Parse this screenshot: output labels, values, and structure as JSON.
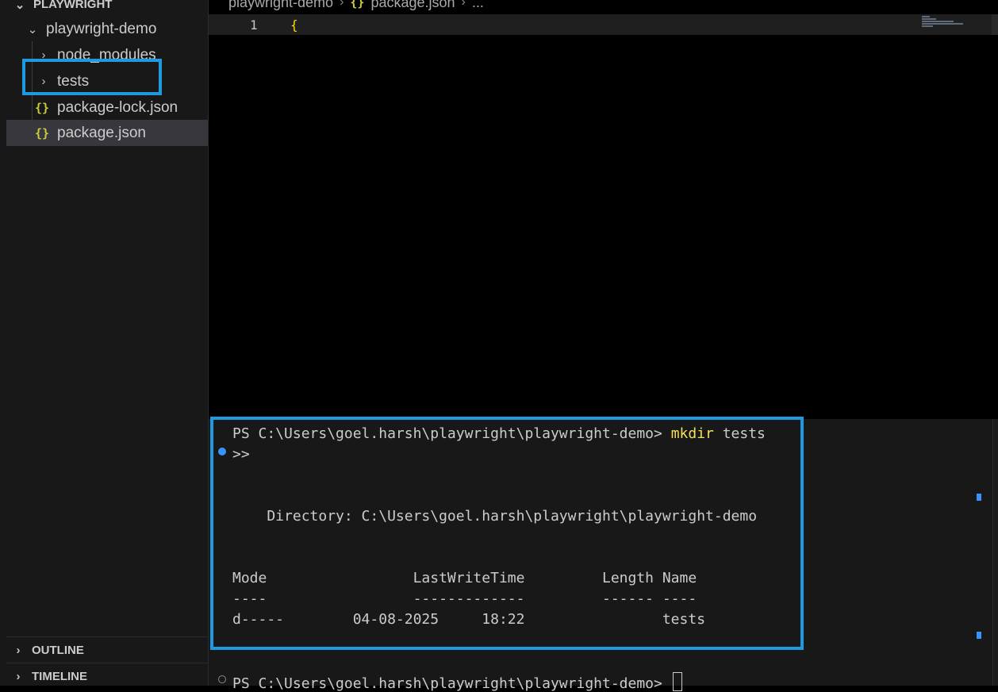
{
  "sidebar": {
    "root_label": "PLAYWRIGHT",
    "items": [
      {
        "label": "playwright-demo",
        "kind": "folder",
        "expanded": true
      },
      {
        "label": "node_modules",
        "kind": "folder",
        "expanded": false
      },
      {
        "label": "tests",
        "kind": "folder",
        "expanded": false
      },
      {
        "label": "package-lock.json",
        "kind": "json-file"
      },
      {
        "label": "package.json",
        "kind": "json-file",
        "selected": true
      }
    ],
    "json_icon_glyph": "{}",
    "outline_label": "OUTLINE",
    "timeline_label": "TIMELINE"
  },
  "editor": {
    "breadcrumb": [
      "playwright-demo",
      "package.json",
      "..."
    ],
    "line_number": "1",
    "line_code": "{"
  },
  "terminal": {
    "lines": [
      {
        "prompt": "PS C:\\Users\\goel.harsh\\playwright\\playwright-demo> ",
        "command": "mkdir",
        "args": " tests"
      },
      {
        "text": ">>"
      },
      {
        "text": "    Directory: C:\\Users\\goel.harsh\\playwright\\playwright-demo"
      },
      {
        "text": "Mode                 LastWriteTime         Length Name"
      },
      {
        "text": "----                 -------------         ------ ----"
      },
      {
        "text": "d-----        04-08-2025     18:22                tests"
      },
      {
        "prompt": "PS C:\\Users\\goel.harsh\\playwright\\playwright-demo> "
      }
    ]
  },
  "colors": {
    "highlight": "#1e9be0",
    "json_icon": "#cbcb41",
    "command": "#f1e05a",
    "selection": "#37373d"
  }
}
